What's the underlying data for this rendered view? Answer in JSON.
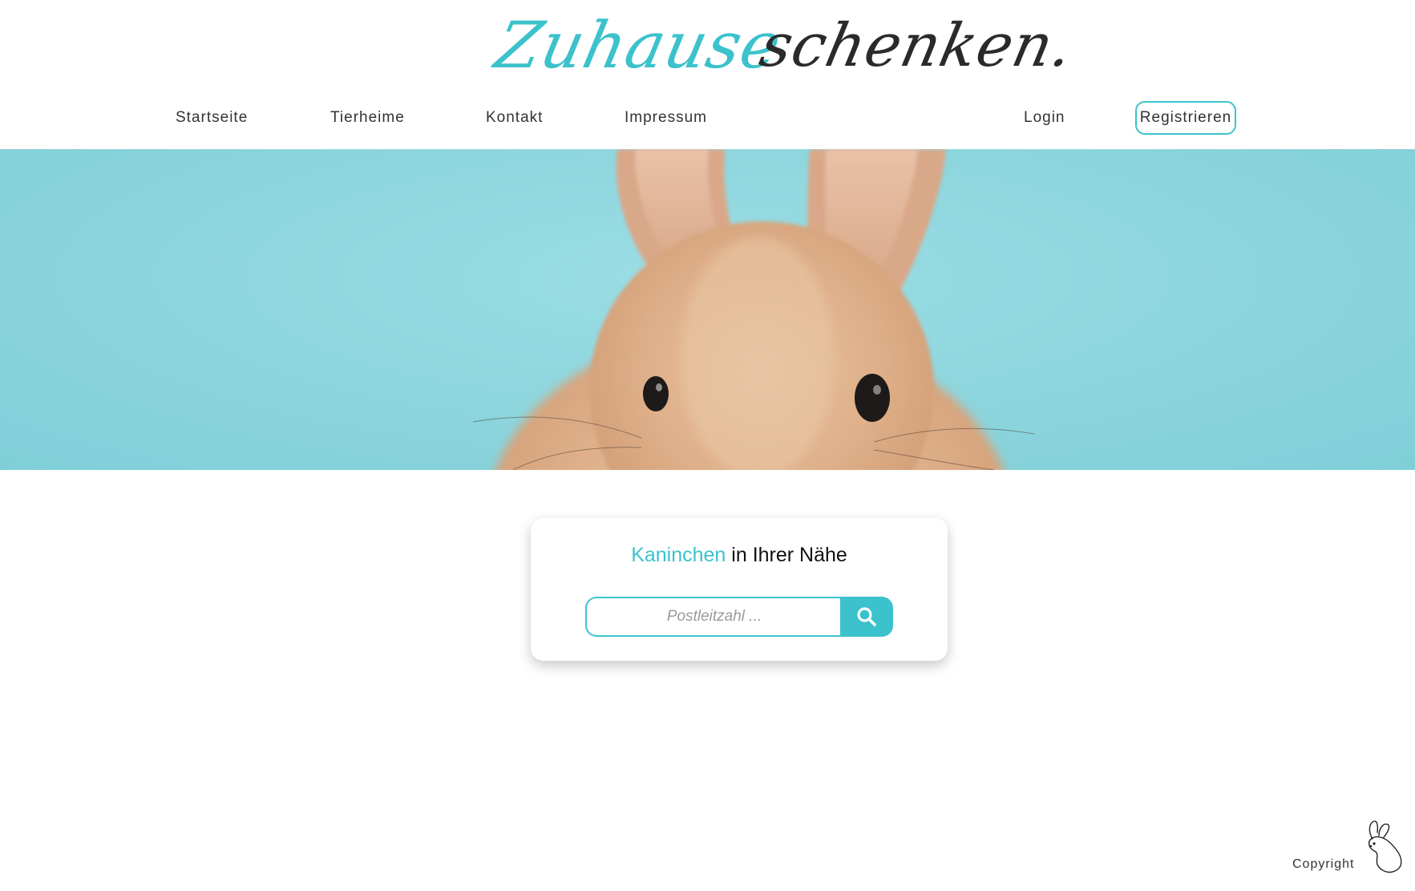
{
  "brand": {
    "logo_part1": "Zuhause",
    "logo_part2": "schenken.",
    "accent_color": "#3cc2cc"
  },
  "nav": {
    "items": [
      {
        "label": "Startseite"
      },
      {
        "label": "Tierheime"
      },
      {
        "label": "Kontakt"
      },
      {
        "label": "Impressum"
      }
    ],
    "login_label": "Login",
    "register_label": "Registrieren"
  },
  "hero": {
    "image": "rabbit-photo"
  },
  "search": {
    "heading_accent": "Kaninchen",
    "heading_rest": " in Ihrer Nähe",
    "placeholder": "Postleitzahl ...",
    "value": "",
    "button_icon": "search-icon"
  },
  "footer": {
    "copyright_label": "Copyright",
    "icon": "bunny-icon"
  }
}
